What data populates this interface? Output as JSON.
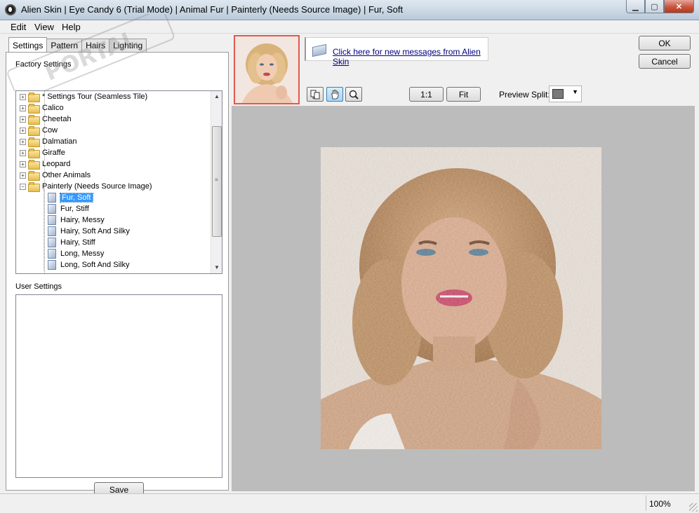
{
  "window": {
    "title": "Alien Skin | Eye Candy 6 (Trial Mode) | Animal Fur | Painterly (Needs Source Image) | Fur, Soft",
    "min_glyph": "▁",
    "max_glyph": "▢",
    "close_glyph": "✕"
  },
  "menu": [
    {
      "label": "Edit"
    },
    {
      "label": "View"
    },
    {
      "label": "Help"
    }
  ],
  "tabs": [
    "Settings",
    "Pattern",
    "Hairs",
    "Lighting"
  ],
  "active_tab": "Settings",
  "factory": {
    "label": "Factory Settings",
    "items": [
      {
        "label": "* Settings Tour (Seamless Tile)",
        "type": "folder",
        "expander": "+"
      },
      {
        "label": "Calico",
        "type": "folder",
        "expander": "+"
      },
      {
        "label": "Cheetah",
        "type": "folder",
        "expander": "+"
      },
      {
        "label": "Cow",
        "type": "folder",
        "expander": "+"
      },
      {
        "label": "Dalmatian",
        "type": "folder",
        "expander": "+"
      },
      {
        "label": "Giraffe",
        "type": "folder",
        "expander": "+"
      },
      {
        "label": "Leopard",
        "type": "folder",
        "expander": "+"
      },
      {
        "label": "Other Animals",
        "type": "folder",
        "expander": "+"
      },
      {
        "label": "Painterly (Needs Source Image)",
        "type": "folder",
        "expander": "−"
      },
      {
        "label": "Fur, Soft",
        "type": "preset",
        "selected": true
      },
      {
        "label": "Fur, Stiff",
        "type": "preset"
      },
      {
        "label": "Hairy, Messy",
        "type": "preset"
      },
      {
        "label": "Hairy, Soft And Silky",
        "type": "preset"
      },
      {
        "label": "Hairy, Stiff",
        "type": "preset"
      },
      {
        "label": "Long, Messy",
        "type": "preset"
      },
      {
        "label": "Long, Soft And Silky",
        "type": "preset"
      }
    ]
  },
  "user_settings": {
    "label": "User Settings"
  },
  "save_label": "Save",
  "ok_label": "OK",
  "cancel_label": "Cancel",
  "message_link": "Click here for new messages from Alien Skin",
  "zoom_1to1": "1:1",
  "fit_label": "Fit",
  "preview_split_label": "Preview Split::",
  "status": {
    "zoom": "100%"
  },
  "colors": {
    "selection": "#3399ff",
    "thumb_border": "#e0584f",
    "preview_bg": "#bcbcbc"
  },
  "icons": [
    "app-logo-icon",
    "swap-icon",
    "hand-pan-icon",
    "zoom-magnifier-icon",
    "message-envelope-icon"
  ]
}
